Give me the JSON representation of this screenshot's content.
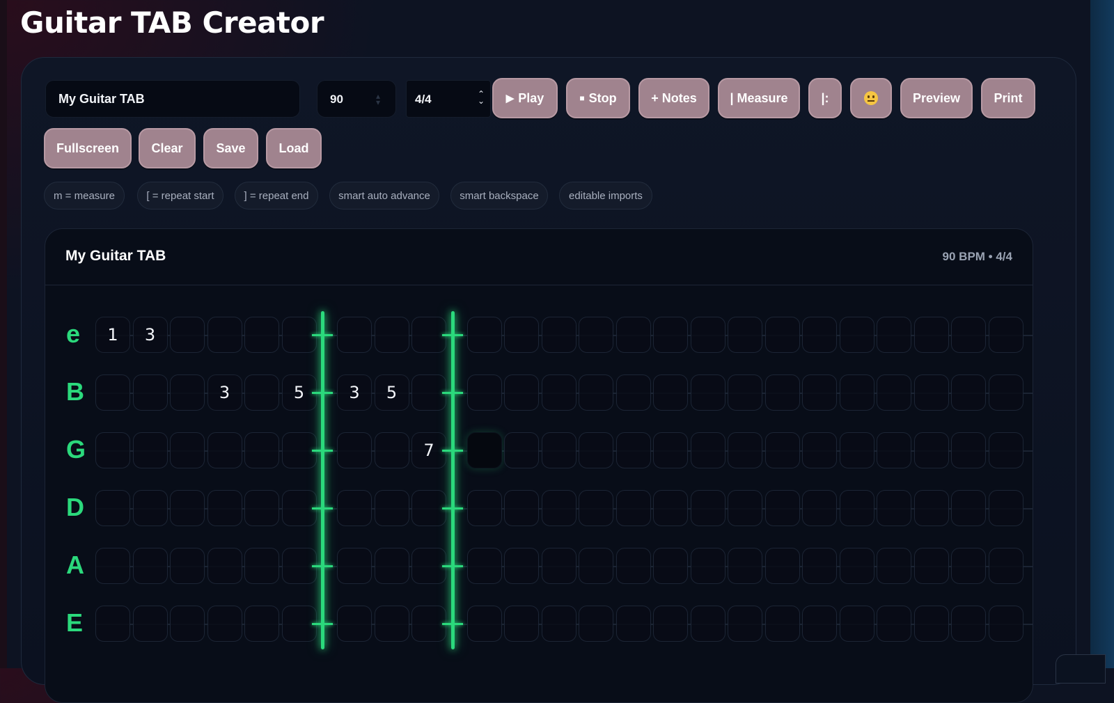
{
  "app": {
    "title": "Guitar TAB Creator"
  },
  "toolbar": {
    "title_value": "My Guitar TAB",
    "bpm_value": "90",
    "time_signature": "4/4",
    "play_label": "Play",
    "stop_label": "Stop",
    "notes_label": "+ Notes",
    "measure_label": "| Measure",
    "repeat_label": "|:",
    "preview_label": "Preview",
    "print_label": "Print",
    "fullscreen_label": "Fullscreen",
    "clear_label": "Clear",
    "save_label": "Save",
    "load_label": "Load"
  },
  "hints": [
    "m = measure",
    "[ = repeat start",
    "] = repeat end",
    "smart auto advance",
    "smart backspace",
    "editable imports"
  ],
  "tab": {
    "title": "My Guitar TAB",
    "meta": "90 BPM • 4/4",
    "strings": [
      "e",
      "B",
      "G",
      "D",
      "A",
      "E"
    ],
    "measure_after_columns": [
      6,
      9
    ],
    "active_cell": {
      "string": 2,
      "column": 9
    },
    "notes": [
      {
        "string": 0,
        "column": 0,
        "fret": "1"
      },
      {
        "string": 0,
        "column": 1,
        "fret": "3"
      },
      {
        "string": 1,
        "column": 3,
        "fret": "3"
      },
      {
        "string": 1,
        "column": 5,
        "fret": "5"
      },
      {
        "string": 1,
        "column": 6,
        "fret": "3"
      },
      {
        "string": 1,
        "column": 7,
        "fret": "5"
      },
      {
        "string": 2,
        "column": 8,
        "fret": "7"
      }
    ]
  },
  "colors": {
    "accent": "#2bd97c",
    "button": "#a0838e",
    "background": "#0d1322"
  }
}
